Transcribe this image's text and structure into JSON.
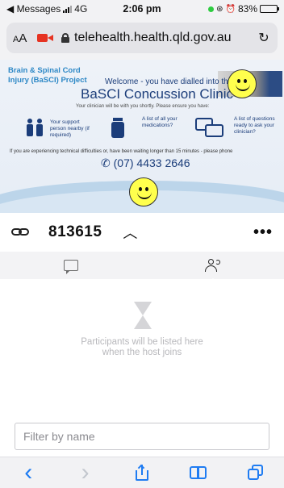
{
  "status_bar": {
    "back_app": "◀ Messages",
    "network": "4G",
    "time": "2:06 pm",
    "battery": "83%",
    "battery_level": 0.83,
    "battery_color": "#f5c400"
  },
  "browser": {
    "text_size_label": "AA",
    "url": "telehealth.health.qld.gov.au",
    "reload_icon": "reload-icon"
  },
  "banner": {
    "org_name": "Brain & Spinal Cord Injury (BaSCI) Project",
    "welcome": "Welcome - you have dialled into the",
    "clinic_name": "BaSCI Concussion Clinic",
    "shortly": "Your clinician will be with you shortly. Please ensure you have:",
    "item_support": "Your support person nearby (if required)",
    "item_medications": "A list of all your medications?",
    "item_questions": "A list of questions ready to ask your clinician?",
    "help_text": "If you are experiencing technical difficulties or, have been waiting longer than 15 minutes - please phone",
    "phone": "(07) 4433 2646"
  },
  "meeting": {
    "id": "813615",
    "chevron": "^",
    "more": "•••"
  },
  "tabs": [
    {
      "name": "chat",
      "icon": "chat-icon"
    },
    {
      "name": "participants",
      "icon": "people-icon",
      "active": true
    }
  ],
  "participants": {
    "empty_message": "Participants will be listed here when the host joins",
    "filter_placeholder": "Filter by name"
  },
  "toolbar": {
    "back": "‹",
    "forward": "›",
    "accent_color": "#1f7cf2"
  }
}
